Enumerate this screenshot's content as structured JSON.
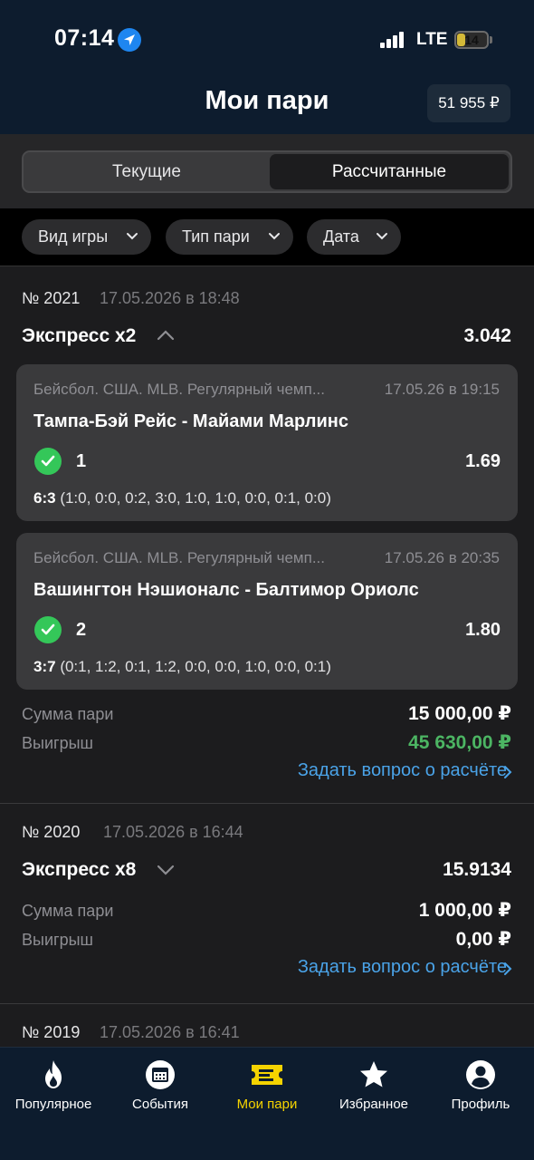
{
  "status_bar": {
    "time": "07:14",
    "network": "LTE",
    "battery_level": "14",
    "battery_fraction": 0.14,
    "battery_color": "#d4b938"
  },
  "header": {
    "title": "Мои пари",
    "balance": "51 955 ₽"
  },
  "segments": {
    "current": "Текущие",
    "settled": "Рассчитанные",
    "selected": "settled"
  },
  "filters": [
    {
      "label": "Вид игры"
    },
    {
      "label": "Тип пари"
    },
    {
      "label": "Дата"
    }
  ],
  "bets": [
    {
      "number": "№ 2021",
      "date": "17.05.2026 в 18:48",
      "type": "Экспресс x2",
      "odds": "3.042",
      "expanded": true,
      "events": [
        {
          "league": "Бейсбол. США. MLB. Регулярный чемп...",
          "time": "17.05.26 в 19:15",
          "teams": "Тампа-Бэй Рейс - Майами Марлинс",
          "outcome": "1",
          "coef": "1.69",
          "score": "6:3",
          "periods": "(1:0, 0:0, 0:2, 3:0, 1:0, 1:0, 0:0, 0:1, 0:0)",
          "status": "won"
        },
        {
          "league": "Бейсбол. США. MLB. Регулярный чемп...",
          "time": "17.05.26 в 20:35",
          "teams": "Вашингтон Нэшионалс - Балтимор Ориолс",
          "outcome": "2",
          "coef": "1.80",
          "score": "3:7",
          "periods": "(0:1, 1:2, 0:1, 1:2, 0:0, 0:0, 1:0, 0:0, 0:1)",
          "status": "won"
        }
      ],
      "stake_label": "Сумма пари",
      "stake": "15 000,00 ₽",
      "win_label": "Выигрыш",
      "win": "45 630,00 ₽",
      "ask": "Задать вопрос о расчёте"
    },
    {
      "number": "№ 2020",
      "date": "17.05.2026 в 16:44",
      "type": "Экспресс x8",
      "odds": "15.9134",
      "expanded": false,
      "stake_label": "Сумма пари",
      "stake": "1 000,00 ₽",
      "win_label": "Выигрыш",
      "win": "0,00 ₽",
      "ask": "Задать вопрос о расчёте"
    },
    {
      "number": "№ 2019",
      "date": "17.05.2026 в 16:41"
    }
  ],
  "nav": [
    {
      "label": "Популярное",
      "icon": "flame-icon"
    },
    {
      "label": "События",
      "icon": "calendar-icon"
    },
    {
      "label": "Мои пари",
      "icon": "ticket-icon",
      "active": true
    },
    {
      "label": "Избранное",
      "icon": "star-icon"
    },
    {
      "label": "Профиль",
      "icon": "profile-icon"
    }
  ],
  "colors": {
    "header_bg": "#0d1c2e",
    "accent_yellow": "#f5d300",
    "win_green": "#4cb563",
    "link_blue": "#4aa3e8",
    "check_green": "#34c759"
  }
}
